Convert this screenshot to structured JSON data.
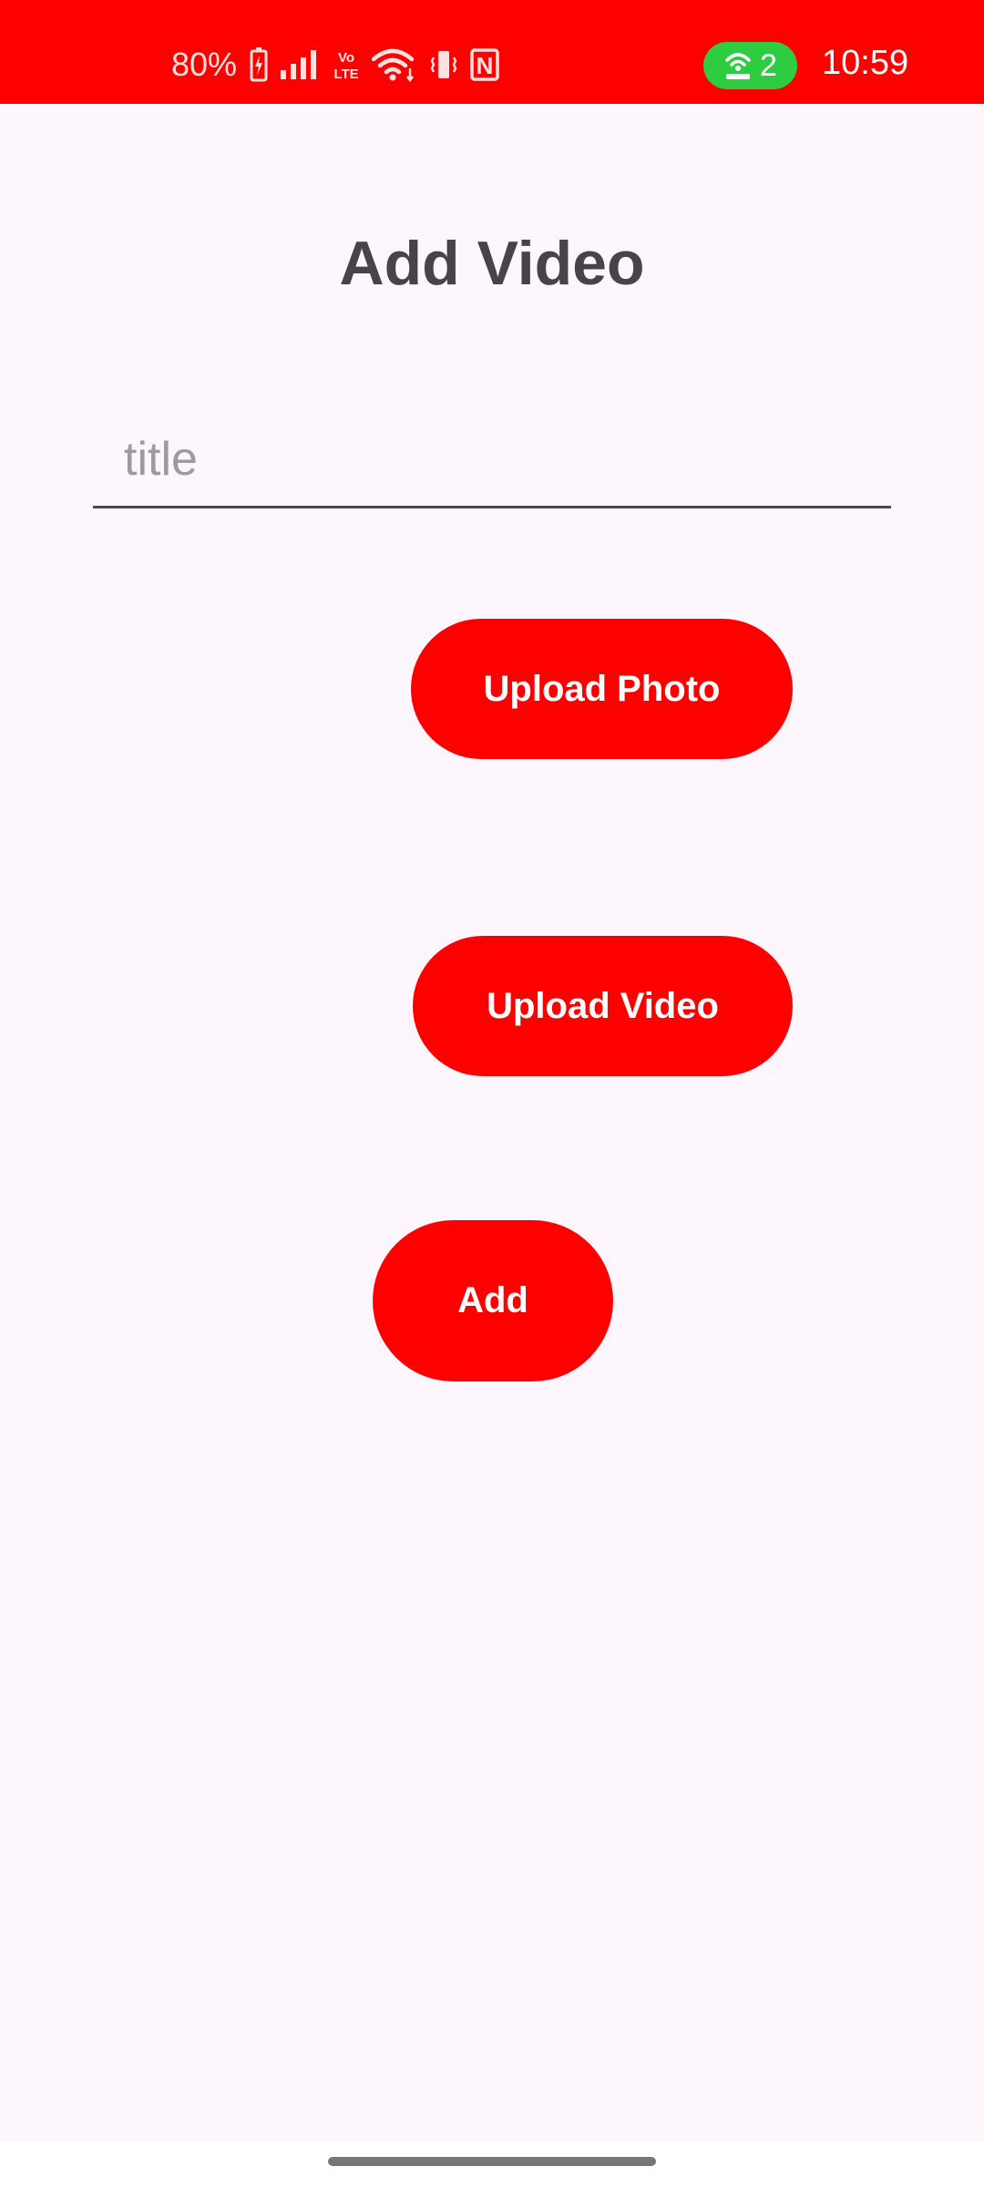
{
  "status_bar": {
    "battery": "80%",
    "hotspot_count": "2",
    "time": "10:59",
    "volte_line1": "Vo",
    "volte_line2": "LTE",
    "nfc": "N",
    "background_color": "#ff0000",
    "hotspot_color": "#2ecc40"
  },
  "page": {
    "title": "Add Video"
  },
  "title_input": {
    "value": "",
    "placeholder": "title"
  },
  "buttons": {
    "upload_photo": "Upload Photo",
    "upload_video": "Upload Video",
    "add": "Add",
    "color": "#ff0000"
  }
}
